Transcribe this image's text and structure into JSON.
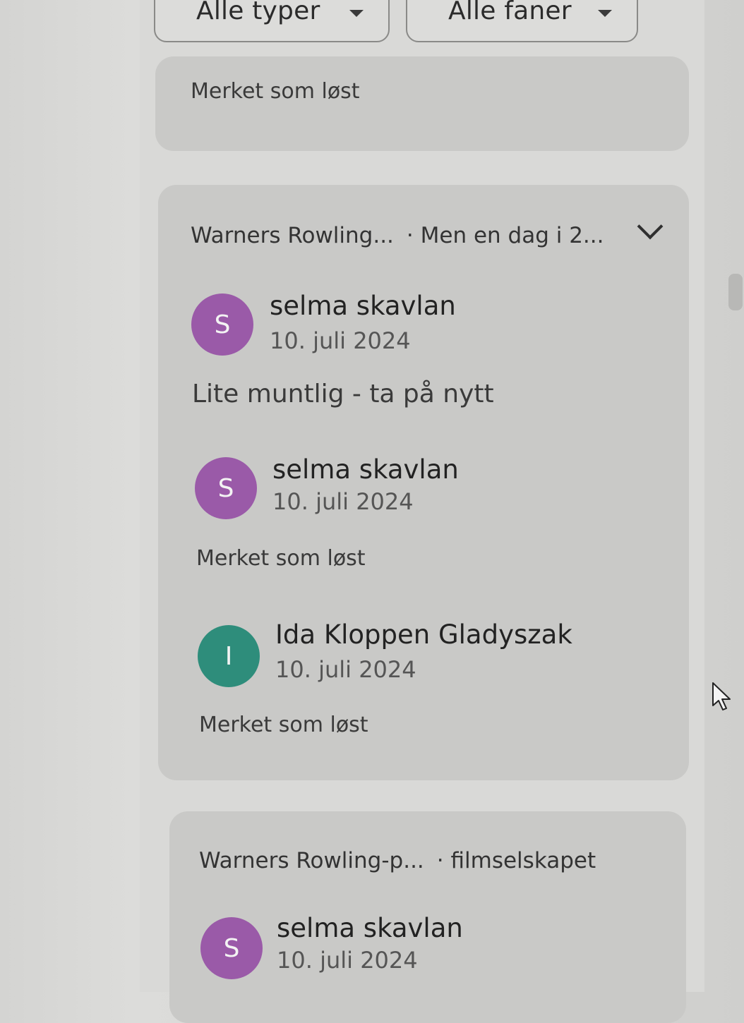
{
  "filters": {
    "types_label": "Alle typer",
    "tabs_label": "Alle faner"
  },
  "cards": {
    "top": {
      "status": "Merket som løst"
    },
    "main": {
      "doc": "Warners Rowling...",
      "excerpt": "· Men en dag i 2...",
      "entries": [
        {
          "initial": "S",
          "author": "selma skavlan",
          "date": "10. juli 2024",
          "text": "Lite muntlig - ta på nytt",
          "avatar_color": "#9a5aa8"
        },
        {
          "initial": "S",
          "author": "selma skavlan",
          "date": "10. juli 2024",
          "text": "Merket som løst",
          "avatar_color": "#9a5aa8"
        },
        {
          "initial": "I",
          "author": "Ida Kloppen Gladyszak",
          "date": "10. juli 2024",
          "text": "Merket som løst",
          "avatar_color": "#2e8d7b"
        }
      ]
    },
    "bottom": {
      "doc": "Warners Rowling-p...",
      "excerpt": "· filmselskapet",
      "entries": [
        {
          "initial": "S",
          "author": "selma skavlan",
          "date": "10. juli 2024",
          "avatar_color": "#9a5aa8"
        }
      ]
    }
  },
  "icons": {
    "expand": "chevron-down-icon",
    "dropdown": "caret-down-icon",
    "pointer": "mouse-pointer-icon"
  }
}
